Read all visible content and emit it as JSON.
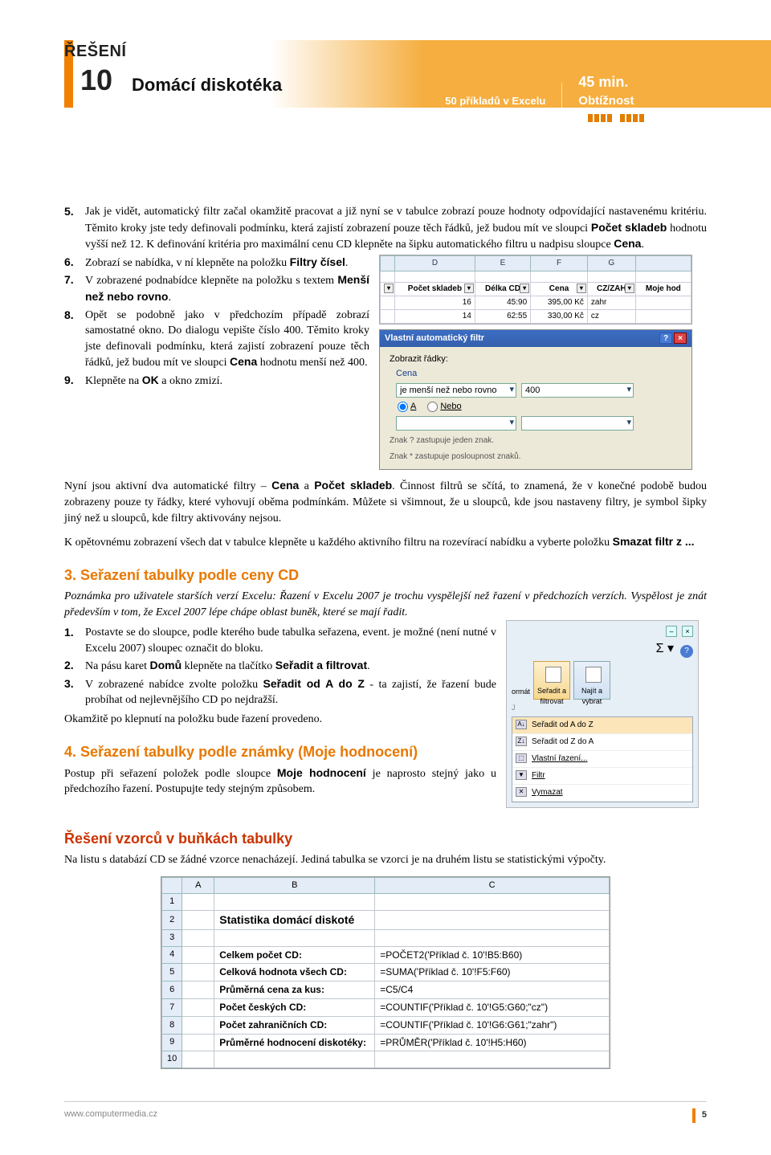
{
  "header": {
    "reseni_label": "ŘEŠENÍ",
    "reseni_num": "10",
    "title": "Domácí diskotéka",
    "subtitle": "50 příkladů v Excelu",
    "duration": "45 min.",
    "difficulty_label": "Obtížnost",
    "difficulty_min": "0",
    "difficulty_max": "10"
  },
  "steps_a": {
    "5": "Jak je vidět, automatický filtr začal okamžitě pracovat a již nyní se v tabulce zobrazí pouze hodnoty odpovídající nastavenému kritériu. Těmito kroky jste tedy definovali podmínku, která zajistí zobrazení pouze těch řádků, jež budou mít ve sloupci ",
    "5b": " hodnotu vyšší než 12. K definování kritéria pro maximální cenu CD klepněte na šipku automatického filtru u nadpisu sloupce ",
    "5c": ".",
    "pocet_skladeb": "Počet skladeb",
    "cena": "Cena",
    "6": "Zobrazí se nabídka, v ní klepněte na položku ",
    "filtry_cisel": "Filtry čísel",
    "7": "V zobrazené podnabídce klepněte na položku s textem ",
    "mensi_nez": "Menší než nebo rovno",
    "8": "Opět se podobně jako v předchozím případě zobrazí samostatné okno. Do dialogu vepište číslo 400. Těmito kroky jste definovali podmínku, která zajistí zobrazení pouze těch řádků, jež budou mít ve sloupci ",
    "8b": " hodnotu menší než 400.",
    "9": "Klepněte na ",
    "ok": "OK",
    "9b": " a okno zmizí."
  },
  "excel_mini": {
    "cols": [
      "D",
      "E",
      "F",
      "G"
    ],
    "headers": [
      "Počet skladeb",
      "Délka CD",
      "Cena",
      "CZ/ZAH",
      "Moje hod"
    ],
    "rows": [
      [
        "16",
        "45:90",
        "395,00 Kč",
        "zahr",
        ""
      ],
      [
        "14",
        "62:55",
        "330,00 Kč",
        "cz",
        ""
      ]
    ]
  },
  "filter_dialog": {
    "title": "Vlastní automatický filtr",
    "show_rows": "Zobrazit řádky:",
    "field": "Cena",
    "op": "je menší než nebo rovno",
    "val": "400",
    "and": "A",
    "or": "Nebo",
    "hint1": "Znak ? zastupuje jeden znak.",
    "hint2": "Znak * zastupuje posloupnost znaků."
  },
  "para1": "Nyní jsou aktivní dva automatické filtry – ",
  "para1b": " a ",
  "para1c": ". Činnost filtrů se sčítá, to znamená, že v konečné podobě budou zobrazeny pouze ty řádky, které vyhovují oběma podmínkám. Můžete si všimnout, že u sloupců, kde jsou nastaveny filtry, je symbol šipky jiný než u sloupců, kde filtry aktivovány nejsou.",
  "para2": "K opětovnému zobrazení všech dat v tabulce klepněte u každého aktivního filtru na rozevírací nabídku a vyberte položku ",
  "smazat_filtr": "Smazat filtr z ...",
  "h3_sort": "3. Seřazení tabulky podle ceny CD",
  "note_sort": "Poznámka pro uživatele starších verzí Excelu: Řazení v Excelu 2007 je trochu vyspělejší než řazení v předchozích verzích. Vyspělost je znát především v tom, že Excel 2007 lépe chápe oblast buněk, které se mají řadit.",
  "sort_steps": {
    "1": "Postavte se do sloupce, podle kterého bude tabulka seřazena, event. je možné (není nutné v Excelu 2007) sloupec označit do bloku.",
    "2a": "Na pásu karet ",
    "2_domu": "Domů",
    "2b": " klepněte na tlačítko ",
    "2_seradit": "Seřadit a filtrovat",
    "2c": ".",
    "3a": "V zobrazené nabídce zvolte položku ",
    "3_az": "Seřadit od A do Z",
    "3b": " - ta zajistí, že řazení bude probíhat od nejlevnějšího CD po nejdražší."
  },
  "after_sort": "Okamžitě po klepnutí na položku bude řazení provedeno.",
  "h3_sort2": "4. Seřazení tabulky podle známky (Moje hodnocení)",
  "sort2_text": "Postup při seřazení položek podle sloupce ",
  "moje_hodnoceni": "Moje hodnocení",
  "sort2_text2": " je naprosto stejný jako u předchozího řazení. Postupujte tedy stejným způsobem.",
  "h3_vzorce": "Řešení vzorců v buňkách tabulky",
  "vzorce_text": "Na listu s databází CD se žádné vzorce nenacházejí. Jediná tabulka se vzorci je na druhém listu se statistickými výpočty.",
  "ribbon": {
    "format_label": "ormát",
    "sort_filter": "Seřadit a filtrovat",
    "find_select": "Najít a vybrat",
    "menu": [
      "Seřadit od A do Z",
      "Seřadit od Z do A",
      "Vlastní řazení...",
      "Filtr",
      "Vymazat"
    ]
  },
  "stat_table": {
    "title": "Statistika domácí diskoté",
    "cols": [
      "A",
      "B",
      "C"
    ],
    "rows": [
      {
        "n": "1",
        "b": "",
        "c": ""
      },
      {
        "n": "2",
        "b": "Statistika domácí diskoté",
        "c": "",
        "title": true
      },
      {
        "n": "3",
        "b": "",
        "c": ""
      },
      {
        "n": "4",
        "b": "Celkem počet CD:",
        "c": "=POČET2('Příklad č. 10'!B5:B60)"
      },
      {
        "n": "5",
        "b": "Celková hodnota všech CD:",
        "c": "=SUMA('Příklad č. 10'!F5:F60)"
      },
      {
        "n": "6",
        "b": "Průměrná cena za kus:",
        "c": "=C5/C4"
      },
      {
        "n": "7",
        "b": "Počet českých CD:",
        "c": "=COUNTIF('Příklad č. 10'!G5:G60;\"cz\")"
      },
      {
        "n": "8",
        "b": "Počet zahraničních CD:",
        "c": "=COUNTIF('Příklad č. 10'!G6:G61;\"zahr\")"
      },
      {
        "n": "9",
        "b": "Průměrné hodnocení diskotéky:",
        "c": "=PRŮMĚR('Příklad č. 10'!H5:H60)"
      },
      {
        "n": "10",
        "b": "",
        "c": ""
      }
    ]
  },
  "footer": {
    "url": "www.computermedia.cz",
    "page": "5"
  }
}
